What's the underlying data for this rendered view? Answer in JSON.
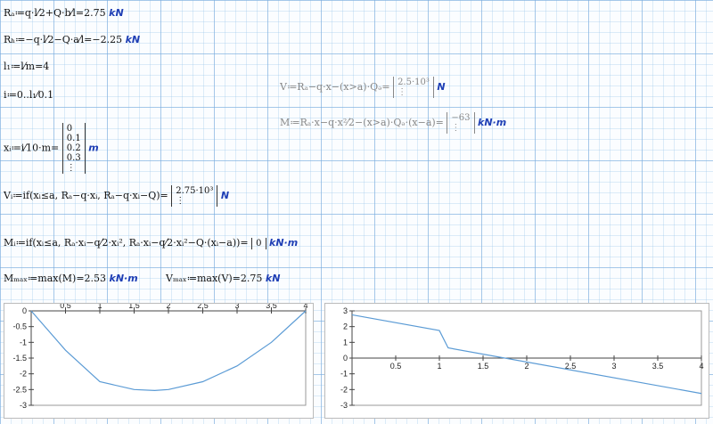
{
  "equations": {
    "ra": "Rₐ≔q·l⁄2+Q·b⁄l=2.75",
    "ra_unit": "kN",
    "rb": "Rₕ≔−q·l⁄2−Q·a⁄l=−2.25",
    "rb_unit": "kN",
    "l1": "l₁≔l⁄m=4",
    "i_range": "i≔0..l₁⁄0.1",
    "x_def": "xᵢ≔i⁄10·m=",
    "x_unit": "m",
    "v_def": "Vᵢ≔if(xᵢ≤a, Rₐ−q·xᵢ, Rₐ−q·xᵢ−Q)=",
    "v_unit": "N",
    "m_def": "Mᵢ≔if(xᵢ≤a, Rₐ·xᵢ−q⁄2·xᵢ², Rₐ·xᵢ−q⁄2·xᵢ²−Q·(xᵢ−a))=",
    "m_unit": "kN·m",
    "mmax": "Mₘₐₓ≔max(M)=2.53",
    "mmax_unit": "kN·m",
    "vmax": "Vₘₐₓ≔max(V)=2.75",
    "vmax_unit": "kN",
    "v_sym": "V≔Rₐ−q·x−(x>a)·Qₔ=",
    "v_sym_unit": "N",
    "m_sym": "M≔Rₐ·x−q·x²⁄2−(x>a)·Qₔ·(x−a)=",
    "m_sym_unit": "kN·m"
  },
  "matrices": {
    "x_values": [
      "0",
      "0.1",
      "0.2",
      "0.3",
      "⋮"
    ],
    "v_values": [
      "2.75·10³",
      "⋮"
    ],
    "m_values": [
      "0"
    ],
    "v_sym_values": [
      "2.5·10³",
      "⋮"
    ],
    "m_sym_values": [
      "−63",
      "⋮"
    ]
  },
  "chart_data": [
    {
      "type": "line",
      "xlim": [
        0,
        4
      ],
      "ylim": [
        -3,
        0
      ],
      "x_ticks": [
        "0.5",
        "1",
        "1.5",
        "2",
        "2.5",
        "3",
        "3.5",
        "4"
      ],
      "y_ticks": [
        "0",
        "-0.5",
        "-1",
        "-1.5",
        "-2",
        "-2.5",
        "-3"
      ],
      "x": [
        0,
        0.5,
        1,
        1.5,
        1.8,
        2,
        2.5,
        3,
        3.5,
        4
      ],
      "y": [
        0,
        -1.25,
        -2.25,
        -2.5,
        -2.53,
        -2.5,
        -2.25,
        -1.75,
        -1.0,
        0
      ],
      "color": "#5b9bd5"
    },
    {
      "type": "line",
      "xlim": [
        0,
        4
      ],
      "ylim": [
        -3,
        3
      ],
      "x_ticks": [
        "0.5",
        "1",
        "1.5",
        "2",
        "2.5",
        "3",
        "3.5",
        "4"
      ],
      "y_ticks": [
        "3",
        "2",
        "1",
        "0",
        "-1",
        "-2",
        "-3"
      ],
      "x": [
        0,
        1.0,
        1.1,
        4
      ],
      "y": [
        2.75,
        1.75,
        0.65,
        -2.25
      ],
      "color": "#5b9bd5"
    }
  ]
}
